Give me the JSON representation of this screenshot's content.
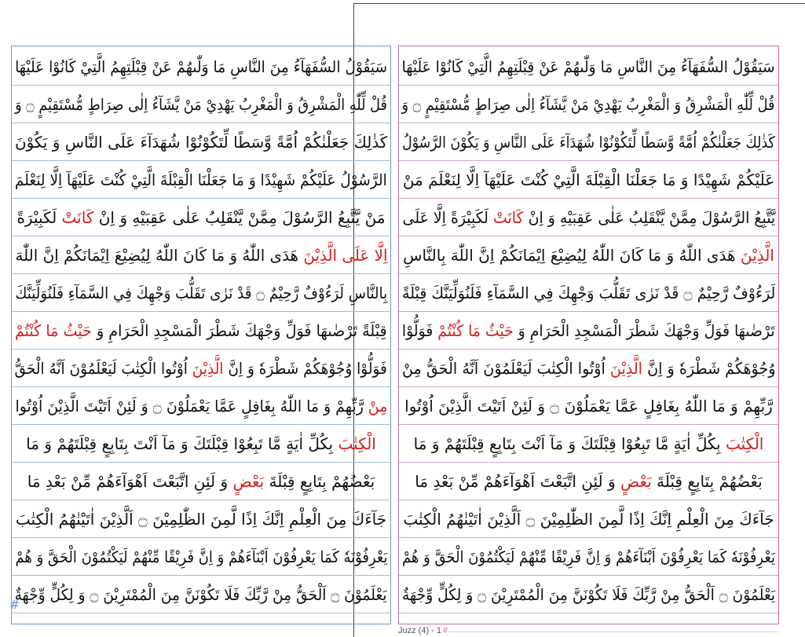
{
  "pages": {
    "left": {
      "lines": [
        {
          "text": "سَيَقُوْلُ السُّفَهَآءُ مِنَ النَّاسِ مَا وَلّٰىهُمْ عَنْ قِبْلَتِهِمُ الَّتِيْ كَانُوْا عَلَيْهَا",
          "highlight": ""
        },
        {
          "text": "قُلْ لِّلّٰهِ الْمَشْرِقُ وَ الْمَغْرِبُ يَهْدِيْ مَنْ يَّشَآءُ اِلٰى صِرَاطٍ مُّسْتَقِيْمٍ ۝ وَ",
          "highlight": ""
        },
        {
          "text": "كَذٰلِكَ جَعَلْنٰكُمْ اُمَّةً وَّسَطًا لِّتَكُوْنُوْا شُهَدَآءَ عَلَى النَّاسِ وَ يَكُوْنَ",
          "highlight": ""
        },
        {
          "text": "الرَّسُوْلُ عَلَيْكُمْ شَهِيْدًا وَ مَا جَعَلْنَا الْقِبْلَةَ الَّتِيْ كُنْتَ عَلَيْهَآ اِلَّا لِنَعْلَمَ",
          "highlight": ""
        },
        {
          "text": "مَنْ يَّتَّبِعُ الرَّسُوْلَ مِمَّنْ يَّنْقَلِبُ عَلٰى عَقِبَيْهِ وَ اِنْ كَانَتْ لَكَبِيْرَةً",
          "highlight": "كَانَتْ"
        },
        {
          "text": "اِلَّا عَلَى الَّذِيْنَ هَدَى اللّٰهُ وَ مَا كَانَ اللّٰهُ لِيُضِيْعَ اِيْمَانَكُمْ اِنَّ اللّٰهَ",
          "highlight": "اِلَّا عَلَى الَّذِيْنَ"
        },
        {
          "text": "بِالنَّاسِ لَرَءُوْفٌ رَّحِيْمٌ ۝ قَدْ نَرٰى تَقَلُّبَ وَجْهِكَ فِي السَّمَآءِ فَلَنُوَلِّيَنَّكَ",
          "highlight": ""
        },
        {
          "text": "قِبْلَةً تَرْضٰىهَا فَوَلِّ وَجْهَكَ شَطْرَ الْمَسْجِدِ الْحَرَامِ وَ حَيْثُ مَا كُنْتُمْ",
          "highlight": "حَيْثُ مَا كُنْتُمْ"
        },
        {
          "text": "فَوَلُّوْا وُجُوْهَكُمْ شَطْرَهٗ وَ اِنَّ الَّذِيْنَ اُوْتُوا الْكِتٰبَ لَيَعْلَمُوْنَ اَنَّهُ الْحَقُّ",
          "highlight": "الَّذِيْنَ"
        },
        {
          "text": "مِنْ رَّبِّهِمْ وَ مَا اللّٰهُ بِغَافِلٍ عَمَّا يَعْمَلُوْنَ ۝ وَ لَئِنْ اَتَيْتَ الَّذِيْنَ اُوْتُوا",
          "highlight": "مِنْ"
        },
        {
          "text": "الْكِتٰبَ بِكُلِّ اٰيَةٍ مَّا تَبِعُوْا قِبْلَتَكَ وَ مَآ اَنْتَ بِتَابِعٍ قِبْلَتَهُمْ وَ مَا",
          "highlight": "الْكِتٰبَ"
        },
        {
          "text": "بَعْضُهُمْ بِتَابِعٍ قِبْلَةَ بَعْضٍ وَ لَئِنِ اتَّبَعْتَ اَهْوَآءَهُمْ مِّنْ بَعْدِ مَا",
          "highlight": "بَعْضٍ"
        },
        {
          "text": "جَآءَكَ مِنَ الْعِلْمِ اِنَّكَ اِذًا لَّمِنَ الظّٰلِمِيْنَ ۝ اَلَّذِيْنَ اٰتَيْنٰهُمُ الْكِتٰبَ",
          "highlight": ""
        },
        {
          "text": "يَعْرِفُوْنَهٗ كَمَا يَعْرِفُوْنَ اَبْنَآءَهُمْ وَ اِنَّ فَرِيْقًا مِّنْهُمْ لَيَكْتُمُوْنَ الْحَقَّ وَ هُمْ",
          "highlight": ""
        },
        {
          "text": "يَعْلَمُوْنَ ۝ اَلْحَقُّ مِنْ رَّبِّكَ فَلَا تَكُوْنَنَّ مِنَ الْمُمْتَرِيْنَ ۝ وَ لِكُلٍّ وِّجْهَةٌ",
          "highlight": ""
        }
      ]
    },
    "right": {
      "lines": [
        {
          "text": "سَيَقُوْلُ السُّفَهَآءُ مِنَ النَّاسِ مَا وَلّٰىهُمْ عَنْ قِبْلَتِهِمُ الَّتِيْ كَانُوْا عَلَيْهَا",
          "highlight": ""
        },
        {
          "text": "قُلْ لِّلّٰهِ الْمَشْرِقُ وَ الْمَغْرِبُ يَهْدِيْ مَنْ يَّشَآءُ اِلٰى صِرَاطٍ مُّسْتَقِيْمٍ ۝ وَ",
          "highlight": ""
        },
        {
          "text": "كَذٰلِكَ جَعَلْنٰكُمْ اُمَّةً وَّسَطًا لِّتَكُوْنُوْا شُهَدَآءَ عَلَى النَّاسِ وَ يَكُوْنَ الرَّسُوْلُ",
          "highlight": ""
        },
        {
          "text": "عَلَيْكُمْ شَهِيْدًا وَ مَا جَعَلْنَا الْقِبْلَةَ الَّتِيْ كُنْتَ عَلَيْهَآ اِلَّا لِنَعْلَمَ مَنْ",
          "highlight": ""
        },
        {
          "text": "يَّتَّبِعُ الرَّسُوْلَ مِمَّنْ يَّنْقَلِبُ عَلٰى عَقِبَيْهِ وَ اِنْ كَانَتْ لَكَبِيْرَةً اِلَّا عَلَى",
          "highlight": "كَانَتْ"
        },
        {
          "text": "الَّذِيْنَ هَدَى اللّٰهُ وَ مَا كَانَ اللّٰهُ لِيُضِيْعَ اِيْمَانَكُمْ اِنَّ اللّٰهَ بِالنَّاسِ",
          "highlight": "الَّذِيْنَ"
        },
        {
          "text": "لَرَءُوْفٌ رَّحِيْمٌ ۝ قَدْ نَرٰى تَقَلُّبَ وَجْهِكَ فِي السَّمَآءِ فَلَنُوَلِّيَنَّكَ قِبْلَةً",
          "highlight": ""
        },
        {
          "text": "تَرْضٰىهَا فَوَلِّ وَجْهَكَ شَطْرَ الْمَسْجِدِ الْحَرَامِ وَ حَيْثُ مَا كُنْتُمْ فَوَلُّوْا",
          "highlight": "حَيْثُ مَا كُنْتُمْ"
        },
        {
          "text": "وُجُوْهَكُمْ شَطْرَهٗ وَ اِنَّ الَّذِيْنَ اُوْتُوا الْكِتٰبَ لَيَعْلَمُوْنَ اَنَّهُ الْحَقُّ مِنْ",
          "highlight": "الَّذِيْنَ"
        },
        {
          "text": "رَّبِّهِمْ وَ مَا اللّٰهُ بِغَافِلٍ عَمَّا يَعْمَلُوْنَ ۝ وَ لَئِنْ اَتَيْتَ الَّذِيْنَ اُوْتُوا",
          "highlight": ""
        },
        {
          "text": "الْكِتٰبَ بِكُلِّ اٰيَةٍ مَّا تَبِعُوْا قِبْلَتَكَ وَ مَآ اَنْتَ بِتَابِعٍ قِبْلَتَهُمْ وَ مَا",
          "highlight": "الْكِتٰبَ"
        },
        {
          "text": "بَعْضُهُمْ بِتَابِعٍ قِبْلَةَ بَعْضٍ وَ لَئِنِ اتَّبَعْتَ اَهْوَآءَهُمْ مِّنْ بَعْدِ مَا",
          "highlight": "بَعْضٍ"
        },
        {
          "text": "جَآءَكَ مِنَ الْعِلْمِ اِنَّكَ اِذًا لَّمِنَ الظّٰلِمِيْنَ ۝ اَلَّذِيْنَ اٰتَيْنٰهُمُ الْكِتٰبَ",
          "highlight": ""
        },
        {
          "text": "يَعْرِفُوْنَهٗ كَمَا يَعْرِفُوْنَ اَبْنَآءَهُمْ وَ اِنَّ فَرِيْقًا مِّنْهُمْ لَيَكْتُمُوْنَ الْحَقَّ وَ هُمْ",
          "highlight": ""
        },
        {
          "text": "يَعْلَمُوْنَ ۝ اَلْحَقُّ مِنْ رَّبِّكَ فَلَا تَكُوْنَنَّ مِنَ الْمُمْتَرِيْنَ ۝ وَ لِكُلٍّ وِّجْهَةٌ",
          "highlight": ""
        }
      ]
    }
  },
  "footer": {
    "label": "Juzz (4) - 1",
    "marker": "#"
  },
  "left_marker": "#",
  "colors": {
    "text": "#111111",
    "highlight": "#d02020",
    "left_frame": "#6b9bd1",
    "right_frame": "#c46fb3"
  }
}
